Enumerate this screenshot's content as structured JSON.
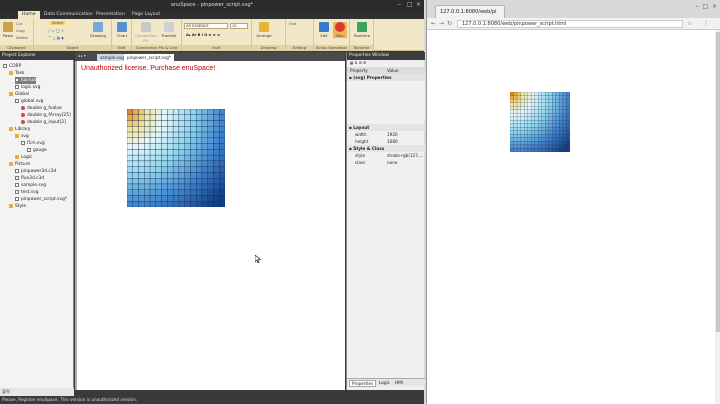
{
  "editor": {
    "title": "enuSpace - pinpower_script.svg*",
    "menu_tabs": [
      "Home",
      "Data Communication",
      "Presentation",
      "Page Layout"
    ],
    "ribbon": {
      "groups": [
        "Clipboard",
        "Object",
        "Edit Object",
        "Connection Pin & Line",
        "Font",
        "Drawing",
        "Editing",
        "Script Operation",
        "Runtime"
      ],
      "paste_label": "Paste",
      "cut_label": "Cut",
      "copy_label": "Copy",
      "delete_label": "Delete",
      "select_label": "Select",
      "drawing_label": "Drawing",
      "chart_label": "Chart",
      "connection_pin_label": "Connection Pin",
      "transfer_label": "Transfer",
      "font_name": "AR ESSENCE",
      "font_size": "10",
      "arrange_label": "Arrange",
      "find_label": "Find",
      "edit_label": "Edit",
      "run_label": "Run",
      "runtime_label": "Runtime"
    },
    "project_explorer": {
      "title": "Project Explorer",
      "items": [
        {
          "label": "CORP",
          "icon": "gear-icon",
          "level": 0
        },
        {
          "label": "Task",
          "icon": "folder-icon",
          "level": 1
        },
        {
          "label": "lua.lua",
          "icon": "gear-icon",
          "level": 2
        },
        {
          "label": "logic.svg",
          "icon": "gear-icon",
          "level": 2
        },
        {
          "label": "Global",
          "icon": "folder-icon",
          "level": 1
        },
        {
          "label": "global.svg",
          "icon": "file-icon",
          "level": 2
        },
        {
          "label": "double g_fvalue",
          "icon": "variable-icon",
          "level": 3
        },
        {
          "label": "double g_fArray[25]",
          "icon": "variable-icon",
          "level": 3
        },
        {
          "label": "double g_input[2]",
          "icon": "variable-icon",
          "level": 3
        },
        {
          "label": "Library",
          "icon": "folder-icon",
          "level": 1
        },
        {
          "label": "svg",
          "icon": "folder-icon",
          "level": 2
        },
        {
          "label": "f1m.svg",
          "icon": "file-icon",
          "level": 3
        },
        {
          "label": "gauge",
          "icon": "file-icon",
          "level": 4
        },
        {
          "label": "Logic",
          "icon": "folder-icon",
          "level": 2
        },
        {
          "label": "Picture",
          "icon": "folder-icon",
          "level": 1
        },
        {
          "label": "pinpower3d.c3d",
          "icon": "file-icon",
          "level": 2
        },
        {
          "label": "flux3d.c3d",
          "icon": "file-icon",
          "level": 2
        },
        {
          "label": "sample.svg",
          "icon": "file-icon",
          "level": 2
        },
        {
          "label": "test.svg",
          "icon": "file-icon",
          "level": 2
        },
        {
          "label": "pinpower_script.svg*",
          "icon": "file-icon",
          "level": 2
        },
        {
          "label": "Style",
          "icon": "folder-icon",
          "level": 1
        }
      ]
    },
    "doc_tabs": [
      "sample.svg",
      "pinpower_script.svg*"
    ],
    "license_message": "Unauthorized license. Purchase enuSpace!",
    "properties": {
      "title": "Properties Window",
      "columns": [
        "Property",
        "Value"
      ],
      "sections": [
        {
          "name": "(svg) Properties",
          "rows": []
        },
        {
          "name": "Layout",
          "rows": [
            {
              "k": "width",
              "v": "1920"
            },
            {
              "k": "height",
              "v": "1080"
            }
          ]
        },
        {
          "name": "Style & Class",
          "rows": [
            {
              "k": "style",
              "v": "stroke-rgb(127,..."
            },
            {
              "k": "class",
              "v": "none"
            }
          ]
        }
      ],
      "bottom_tabs": [
        "Properties",
        "Logic",
        "HMI"
      ]
    },
    "output_tab": "출력",
    "status": "Please, Register enuSpace. This version is unauthorized version."
  },
  "browser": {
    "tab_title": "127.0.0.1:8080/web/pi",
    "url": "127.0.0.1:8080/web/pinpower_script.html"
  },
  "heatmap": {
    "rows": 17,
    "cols": 17,
    "colors": {
      "hot": "#e08a1e",
      "warm": "#f3e79a",
      "light": "#e6f6fb",
      "cyan": "#8ed8f0",
      "blue": "#3f84cf",
      "dark": "#133f86"
    }
  }
}
